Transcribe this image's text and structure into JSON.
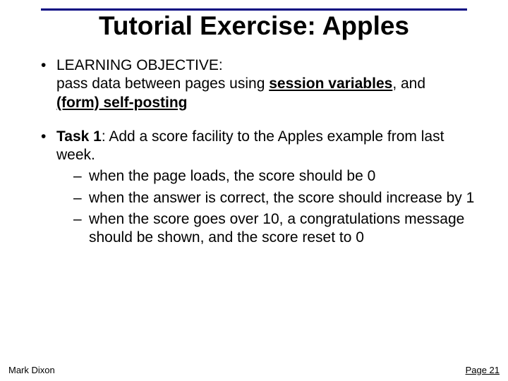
{
  "title": "Tutorial Exercise: Apples",
  "objective": {
    "label": "LEARNING OBJECTIVE:",
    "line_pre": "pass data between pages using ",
    "sess": "session variables",
    "line_mid": ", and ",
    "selfpost": "(form) self-posting"
  },
  "task": {
    "label": "Task 1",
    "desc": ": Add a score facility to the Apples example from last week.",
    "subs": [
      "when the page loads, the score should be 0",
      "when the answer is correct, the score should increase by 1",
      "when the score goes over 10, a congratulations message should be shown, and the score reset to 0"
    ]
  },
  "footer": {
    "author": "Mark Dixon",
    "page": "Page 21"
  }
}
